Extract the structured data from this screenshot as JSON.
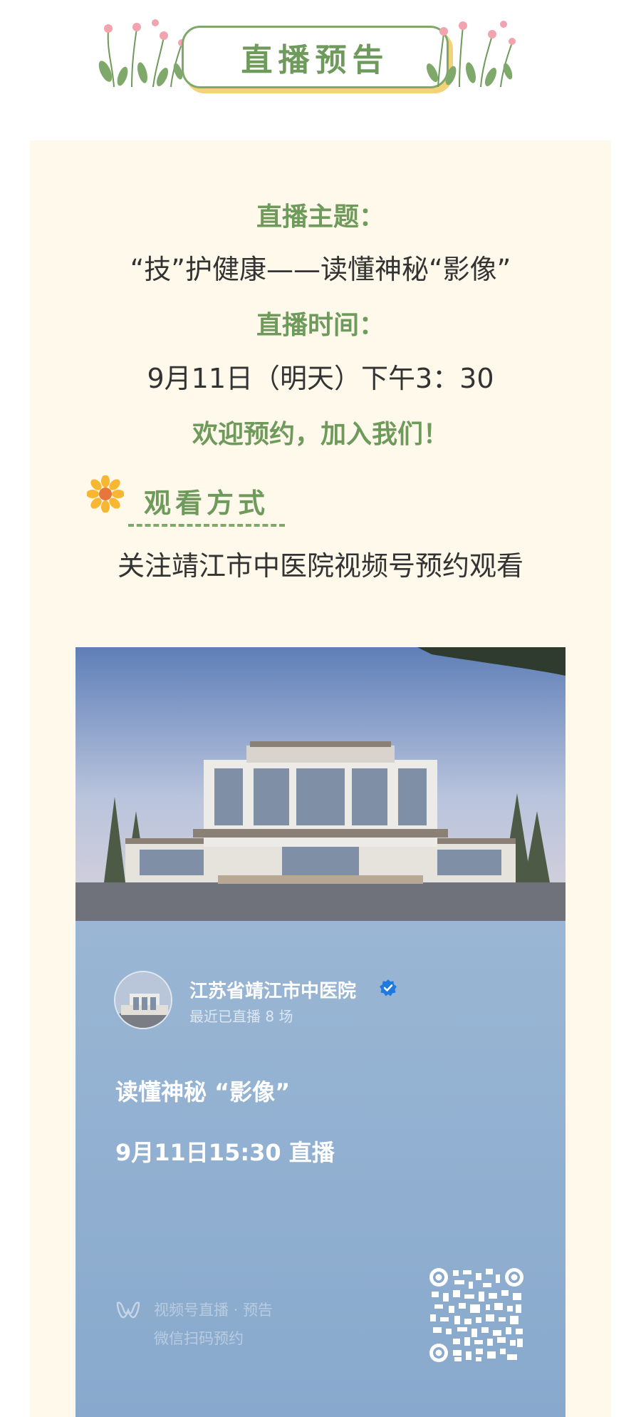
{
  "banner": {
    "title": "直播预告"
  },
  "live": {
    "topic_label": "直播主题：",
    "topic": "“技”护健康——读懂神秘“影像”",
    "time_label": "直播时间：",
    "time": "9月11日（明天）下午3：30",
    "welcome": "欢迎预约，加入我们！"
  },
  "watch": {
    "section_title": "观看方式",
    "instruction": "关注靖江市中医院视频号预约观看"
  },
  "poster": {
    "account_name": "江苏省靖江市中医院",
    "account_sub": "最近已直播 8 场",
    "title": "读懂神秘 “影像”",
    "time": "9月11日15:30 直播",
    "footer_line1": "视频号直播 · 预告",
    "footer_line2": "微信扫码预约"
  },
  "colors": {
    "accent_green": "#6e9a5b",
    "panel_cream": "#fef9ea",
    "poster_blue": "#8fb0d0",
    "pill_shadow_yellow": "#f3d27a"
  }
}
